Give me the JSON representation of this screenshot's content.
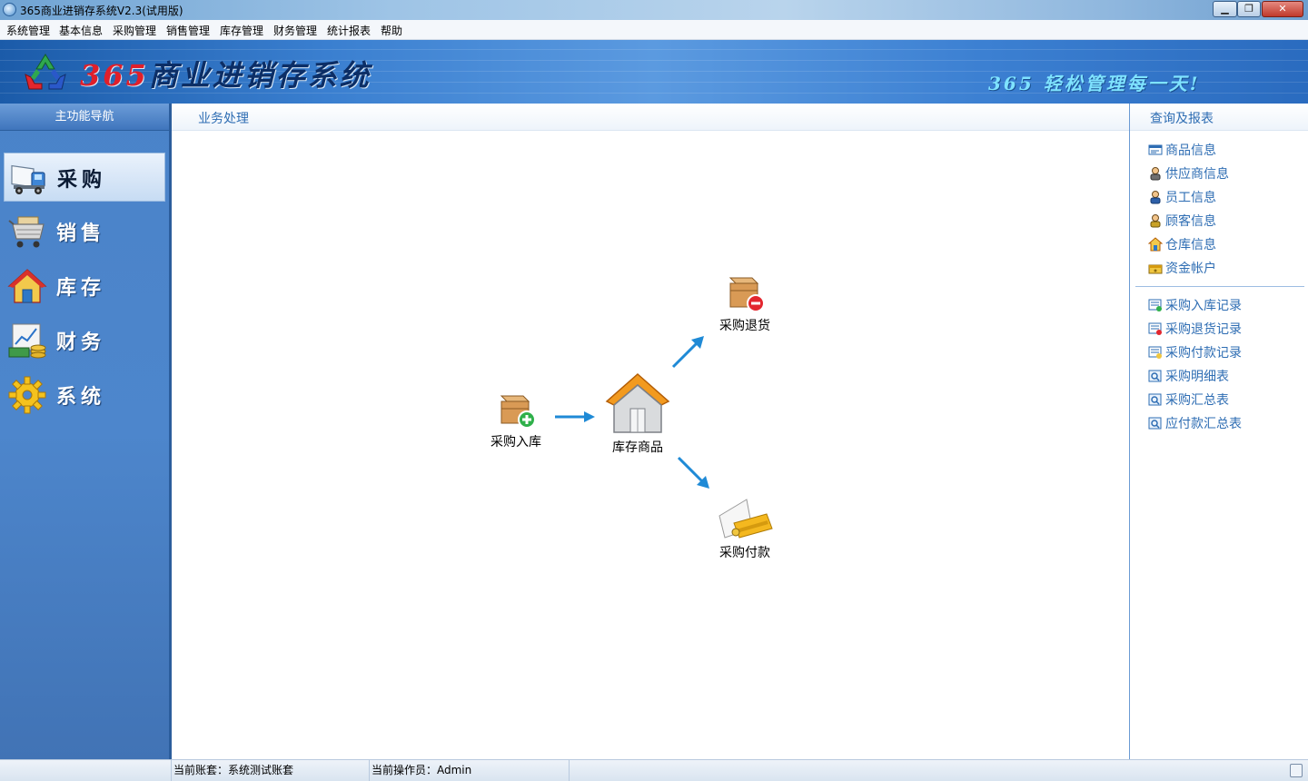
{
  "window": {
    "title": "365商业进销存系统V2.3(试用版)",
    "minimize_glyph": "▁",
    "maximize_glyph": "❐",
    "close_glyph": "✕"
  },
  "menu": [
    "系统管理",
    "基本信息",
    "采购管理",
    "销售管理",
    "库存管理",
    "财务管理",
    "统计报表",
    "帮助"
  ],
  "banner": {
    "title_num": "365",
    "title_text": "商业进销存系统",
    "slogan": "365 轻松管理每一天!"
  },
  "left_nav": {
    "header": "主功能导航",
    "items": [
      {
        "label": "采购",
        "icon": "truck-icon",
        "active": true
      },
      {
        "label": "销售",
        "icon": "shopping-cart-icon",
        "active": false
      },
      {
        "label": "库存",
        "icon": "house-icon",
        "active": false
      },
      {
        "label": "财务",
        "icon": "finance-chart-icon",
        "active": false
      },
      {
        "label": "系统",
        "icon": "gear-icon",
        "active": false
      }
    ]
  },
  "center": {
    "header": "业务处理",
    "nodes": {
      "purchase_in": "采购入库",
      "inventory": "库存商品",
      "purchase_return": "采购退货",
      "purchase_pay": "采购付款"
    }
  },
  "right_panel": {
    "header": "查询及报表",
    "info_links": [
      {
        "label": "商品信息",
        "icon": "product-card-icon"
      },
      {
        "label": "供应商信息",
        "icon": "supplier-person-icon"
      },
      {
        "label": "员工信息",
        "icon": "employee-person-icon"
      },
      {
        "label": "顾客信息",
        "icon": "customer-person-icon"
      },
      {
        "label": "仓库信息",
        "icon": "warehouse-house-icon"
      },
      {
        "label": "资金帐户",
        "icon": "money-account-icon"
      }
    ],
    "report_links": [
      {
        "label": "采购入库记录",
        "icon": "record-form-icon"
      },
      {
        "label": "采购退货记录",
        "icon": "record-form-icon"
      },
      {
        "label": "采购付款记录",
        "icon": "record-form-icon"
      },
      {
        "label": "采购明细表",
        "icon": "report-table-icon"
      },
      {
        "label": "采购汇总表",
        "icon": "report-table-icon"
      },
      {
        "label": "应付款汇总表",
        "icon": "report-table-icon"
      }
    ]
  },
  "status": {
    "account": "当前账套：系统测试账套",
    "operator": "当前操作员：Admin"
  },
  "colors": {
    "link": "#2e6db3",
    "nav_bg": "#4a83c9",
    "banner": "#3a7fd0",
    "arrow": "#1f8ad6"
  }
}
